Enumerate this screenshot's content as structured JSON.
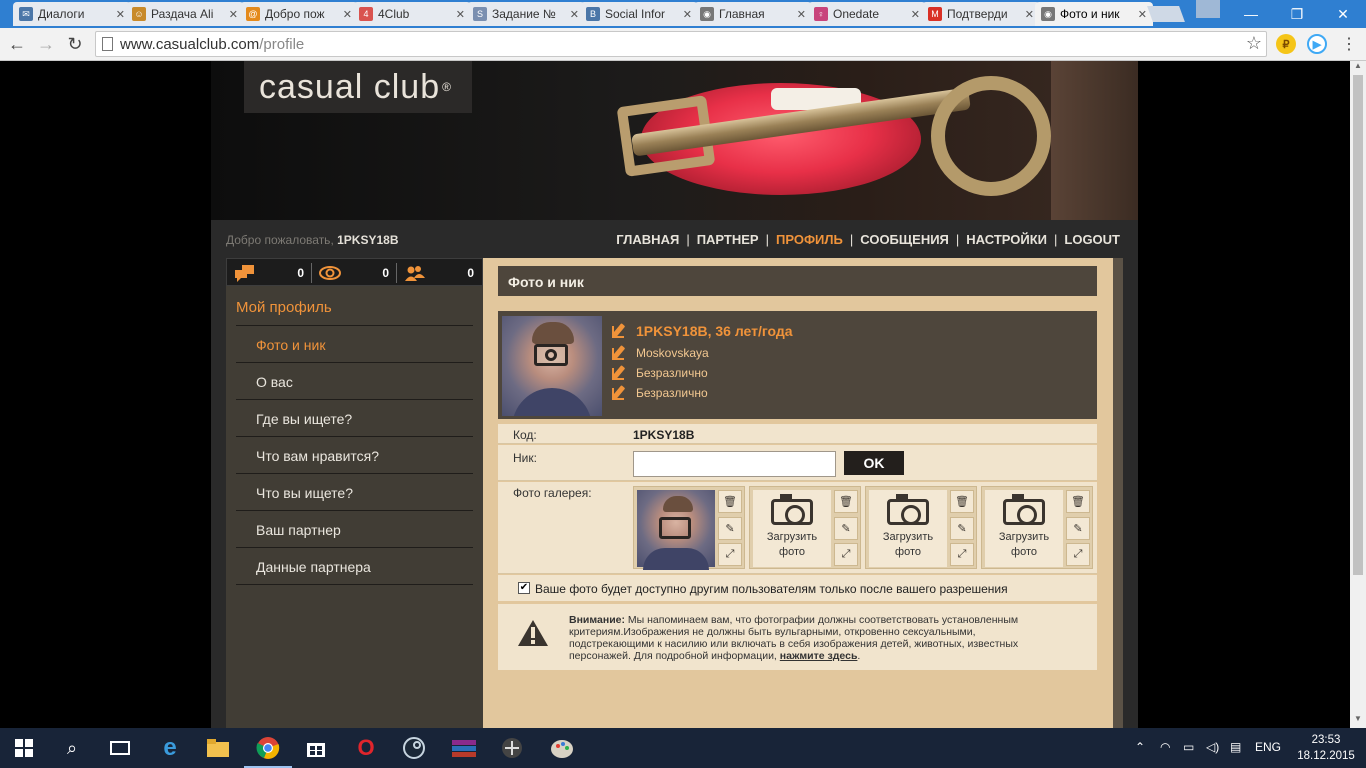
{
  "browser": {
    "tabs": [
      {
        "title": "Диалоги",
        "fav_color": "#4a76a8",
        "fav_glyph": "✉"
      },
      {
        "title": "Раздача Ali",
        "fav_color": "#c88a2a",
        "fav_glyph": "☺"
      },
      {
        "title": "Добро пож",
        "fav_color": "#e48a1c",
        "fav_glyph": "@"
      },
      {
        "title": "4Club",
        "fav_color": "#d9534f",
        "fav_glyph": "4"
      },
      {
        "title": "Задание №",
        "fav_color": "#7a8fb0",
        "fav_glyph": "S"
      },
      {
        "title": "Social Infor",
        "fav_color": "#4a76a8",
        "fav_glyph": "B"
      },
      {
        "title": "Главная",
        "fav_color": "#777777",
        "fav_glyph": "◉"
      },
      {
        "title": "Onedate",
        "fav_color": "#c8447c",
        "fav_glyph": "♀"
      },
      {
        "title": "Подтверди",
        "fav_color": "#d93025",
        "fav_glyph": "M"
      },
      {
        "title": "Фото и ник",
        "fav_color": "#777777",
        "fav_glyph": "◉"
      }
    ],
    "url_domain": "www.casualclub.com",
    "url_path": "/profile"
  },
  "site": {
    "logo": "casual club",
    "logo_mark": "®",
    "welcome_prefix": "Добро пожаловать,",
    "username": "1PKSY18B",
    "nav": [
      {
        "label": "ГЛАВНАЯ",
        "active": false
      },
      {
        "label": "ПАРТНЕР",
        "active": false
      },
      {
        "label": "ПРОФИЛЬ",
        "active": true
      },
      {
        "label": "СООБЩЕНИЯ",
        "active": false
      },
      {
        "label": "НАСТРОЙКИ",
        "active": false
      },
      {
        "label": "LOGOUT",
        "active": false
      }
    ],
    "nav_separator": "|"
  },
  "sidebar": {
    "stats": [
      {
        "icon": "messages-icon",
        "value": "0"
      },
      {
        "icon": "views-icon",
        "value": "0"
      },
      {
        "icon": "contacts-icon",
        "value": "0"
      }
    ],
    "title": "Мой профиль",
    "items": [
      {
        "label": "Фото и ник",
        "active": true
      },
      {
        "label": "О вас",
        "active": false
      },
      {
        "label": "Где вы ищете?",
        "active": false
      },
      {
        "label": "Что вам нравится?",
        "active": false
      },
      {
        "label": "Что вы ищете?",
        "active": false
      },
      {
        "label": "Ваш партнер",
        "active": false
      },
      {
        "label": "Данные партнера",
        "active": false
      }
    ]
  },
  "main": {
    "section_title": "Фото и ник",
    "profile": {
      "headline": "1PKSY18B, 36 лет/года",
      "location": "Moskovskaya",
      "field2": "Безразлично",
      "field3": "Безразлично"
    },
    "code_label": "Код:",
    "code_value": "1PKSY18B",
    "nick_label": "Ник:",
    "nick_value": "",
    "ok_label": "OK",
    "gallery_label": "Фото галерея:",
    "upload_label_1": "Загрузить",
    "upload_label_2": "фото",
    "consent_text": "Ваше фото будет доступно другим пользователям только после вашего разрешения",
    "consent_checked": true,
    "warning_bold": "Внимание:",
    "warning_text": "Мы напоминаем вам, что фотографии должны соответствовать установленным критериям.Изображения не должны быть вульгарными, откровенно сексуальными, подстрекающими к насилию или включать в себя изображения детей, животных, известных персонажей. Для подробной информации,",
    "warning_link": "нажмите здесь",
    "warning_end": "."
  },
  "taskbar": {
    "lang": "ENG",
    "time": "23:53",
    "date": "18.12.2015"
  },
  "colors": {
    "accent": "#f0933a",
    "sidebar_bg": "#413d35",
    "content_bg": "#e2c79d",
    "header_bar": "#4e463c"
  }
}
